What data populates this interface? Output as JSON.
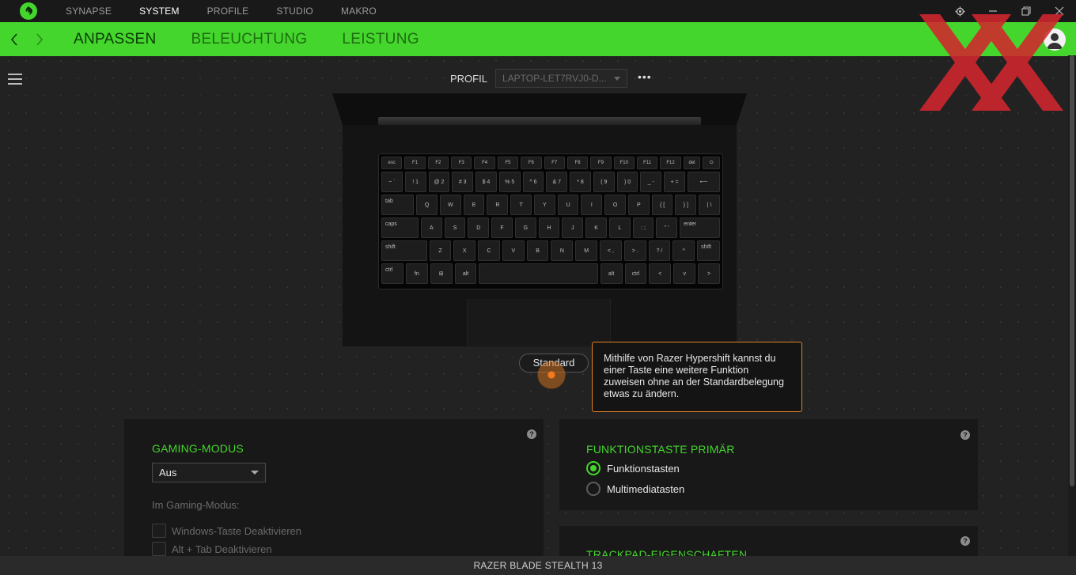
{
  "app": {
    "title": "Razer Synapse"
  },
  "top_tabs": [
    {
      "label": "SYNAPSE"
    },
    {
      "label": "SYSTEM"
    },
    {
      "label": "PROFILE"
    },
    {
      "label": "STUDIO"
    },
    {
      "label": "MAKRO"
    }
  ],
  "window_controls": {
    "settings": "gear-icon",
    "minimize": "minimize-icon",
    "restore": "restore-icon",
    "close": "close-icon"
  },
  "sub_tabs": [
    {
      "label": "ANPASSEN"
    },
    {
      "label": "BELEUCHTUNG"
    },
    {
      "label": "LEISTUNG"
    }
  ],
  "profile": {
    "label": "PROFIL",
    "value": "LAPTOP-LET7RVJ0-D..."
  },
  "keyboard": {
    "rows": [
      [
        "esc",
        "F1",
        "F2",
        "F3",
        "F4",
        "F5",
        "F6",
        "F7",
        "F8",
        "F9",
        "F10",
        "F11",
        "F12",
        "del",
        "⏻"
      ],
      [
        "~ `",
        "! 1",
        "@ 2",
        "# 3",
        "$ 4",
        "% 5",
        "^ 6",
        "& 7",
        "* 8",
        "( 9",
        ") 0",
        "_ -",
        "+ =",
        "⟵"
      ],
      [
        "tab",
        "Q",
        "W",
        "E",
        "R",
        "T",
        "Y",
        "U",
        "I",
        "O",
        "P",
        "{ [",
        "} ]",
        "| \\"
      ],
      [
        "caps",
        "A",
        "S",
        "D",
        "F",
        "G",
        "H",
        "J",
        "K",
        "L",
        ": ;",
        "\" '",
        "enter"
      ],
      [
        "shift",
        "Z",
        "X",
        "C",
        "V",
        "B",
        "N",
        "M",
        "< ,",
        "> .",
        "? /",
        "^",
        "shift"
      ],
      [
        "ctrl",
        "fn",
        "⊞",
        "alt",
        "",
        "alt",
        "ctrl",
        "<",
        "v",
        ">"
      ]
    ]
  },
  "standard_button": {
    "label": "Standard"
  },
  "tooltip": {
    "text": "Mithilfe von Razer Hypershift kannst du einer Taste eine weitere Funktion zuweisen ohne an der Standardbelegung etwas zu ändern."
  },
  "gaming_mode": {
    "title": "GAMING-MODUS",
    "select_value": "Aus",
    "sub_label": "Im Gaming-Modus:",
    "options": [
      {
        "label": "Windows-Taste Deaktivieren"
      },
      {
        "label": "Alt + Tab Deaktivieren"
      }
    ]
  },
  "function_key": {
    "title": "FUNKTIONSTASTE PRIMÄR",
    "options": [
      {
        "label": "Funktionstasten",
        "selected": true
      },
      {
        "label": "Multimediatasten",
        "selected": false
      }
    ]
  },
  "trackpad": {
    "title": "TRACKPAD-EIGENSCHAFTEN"
  },
  "help_symbol": "?",
  "status": {
    "device": "RAZER BLADE STEALTH 13"
  },
  "colors": {
    "accent": "#44d62c",
    "tooltip_border": "#e38125"
  }
}
